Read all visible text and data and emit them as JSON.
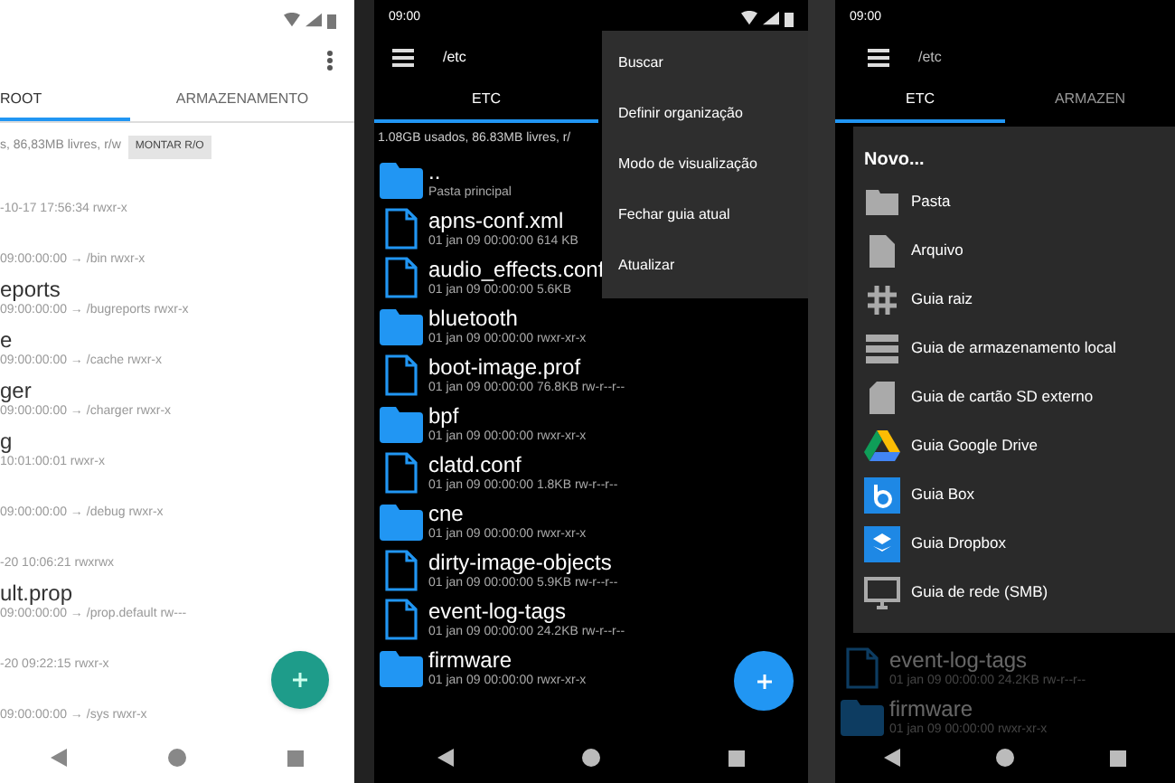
{
  "left_screen": {
    "tabs": [
      {
        "label": "ROOT",
        "selected": true
      },
      {
        "label": "ARMAZENAMENTO",
        "selected": false
      }
    ],
    "info": "s, 86,83MB livres, r/w",
    "mount_button": "MONTAR R/O",
    "rows": [
      {
        "name": "",
        "meta": "-10-17 17:56:34   rwxr-x"
      },
      {
        "name": "",
        "meta": "09:00:00:00  → /bin rwxr-x"
      },
      {
        "name": "eports",
        "meta": "09:00:00:00  → /bugreports rwxr-x"
      },
      {
        "name": "e",
        "meta": "09:00:00:00  → /cache rwxr-x"
      },
      {
        "name": "ger",
        "meta": "09:00:00:00  → /charger rwxr-x"
      },
      {
        "name": "g",
        "meta": "10:01:00:01   rwxr-x"
      },
      {
        "name": "",
        "meta": "09:00:00:00  → /debug rwxr-x"
      },
      {
        "name": "",
        "meta": "-20 10:06:21   rwxrwx"
      },
      {
        "name": "ult.prop",
        "meta": "09:00:00:00  → /prop.default rw---"
      },
      {
        "name": "",
        "meta": "-20 09:22:15   rwxr-x"
      },
      {
        "name": "",
        "meta": "09:00:00:00  → /sys rwxr-x"
      }
    ]
  },
  "middle_screen": {
    "time": "09:00",
    "path": "/etc",
    "tabs": [
      {
        "label": "ETC",
        "selected": true
      }
    ],
    "info": "1.08GB usados, 86.83MB livres, r/",
    "rows": [
      {
        "kind": "folder",
        "name": "..",
        "meta": "Pasta principal"
      },
      {
        "kind": "file",
        "name": "apns-conf.xml",
        "meta": "01 jan 09 00:00:00  614 KB"
      },
      {
        "kind": "file",
        "name": "audio_effects.conf",
        "meta": "01 jan 09 00:00:00  5.6KB"
      },
      {
        "kind": "folder",
        "name": "bluetooth",
        "meta": "01 jan 09 00:00:00   rwxr-xr-x"
      },
      {
        "kind": "file",
        "name": "boot-image.prof",
        "meta": "01 jan 09 00:00:00  76.8KB  rw-r--r--"
      },
      {
        "kind": "folder",
        "name": "bpf",
        "meta": "01 jan 09 00:00:00   rwxr-xr-x"
      },
      {
        "kind": "file",
        "name": "clatd.conf",
        "meta": "01 jan 09 00:00:00  1.8KB  rw-r--r--"
      },
      {
        "kind": "folder",
        "name": "cne",
        "meta": "01 jan 09 00:00:00   rwxr-xr-x"
      },
      {
        "kind": "file",
        "name": "dirty-image-objects",
        "meta": "01 jan 09 00:00:00  5.9KB  rw-r--r--"
      },
      {
        "kind": "file",
        "name": "event-log-tags",
        "meta": "01 jan 09 00:00:00  24.2KB  rw-r--r--"
      },
      {
        "kind": "folder",
        "name": "firmware",
        "meta": "01 jan 09 00:00:00   rwxr-xr-x"
      }
    ],
    "menu": [
      "Buscar",
      "Definir organização",
      "Modo de visualização",
      "Fechar guia atual",
      "Atualizar"
    ]
  },
  "right_screen": {
    "time": "09:00",
    "path": "/etc",
    "tabs": [
      {
        "label": "ETC",
        "selected": true
      },
      {
        "label": "ARMAZEN",
        "selected": false
      }
    ],
    "rows": [
      {
        "kind": "file",
        "name": "event-log-tags",
        "meta": "01 jan 09 00:00:00  24.2KB  rw-r--r--"
      },
      {
        "kind": "folder",
        "name": "firmware",
        "meta": "01 jan 09 00:00:00   rwxr-xr-x"
      }
    ],
    "menu": {
      "title": "Novo...",
      "items": [
        {
          "kind": "folder",
          "label": "Pasta"
        },
        {
          "kind": "file",
          "label": "Arquivo"
        },
        {
          "kind": "root",
          "label": "Guia raiz"
        },
        {
          "kind": "local",
          "label": "Guia de armazenamento local"
        },
        {
          "kind": "sdcard",
          "label": "Guia de cartão SD externo"
        },
        {
          "kind": "drive",
          "label": "Guia Google Drive"
        },
        {
          "kind": "box",
          "label": "Guia Box"
        },
        {
          "kind": "dropbox",
          "label": "Guia Dropbox"
        },
        {
          "kind": "network",
          "label": "Guia de rede (SMB)"
        }
      ]
    }
  }
}
